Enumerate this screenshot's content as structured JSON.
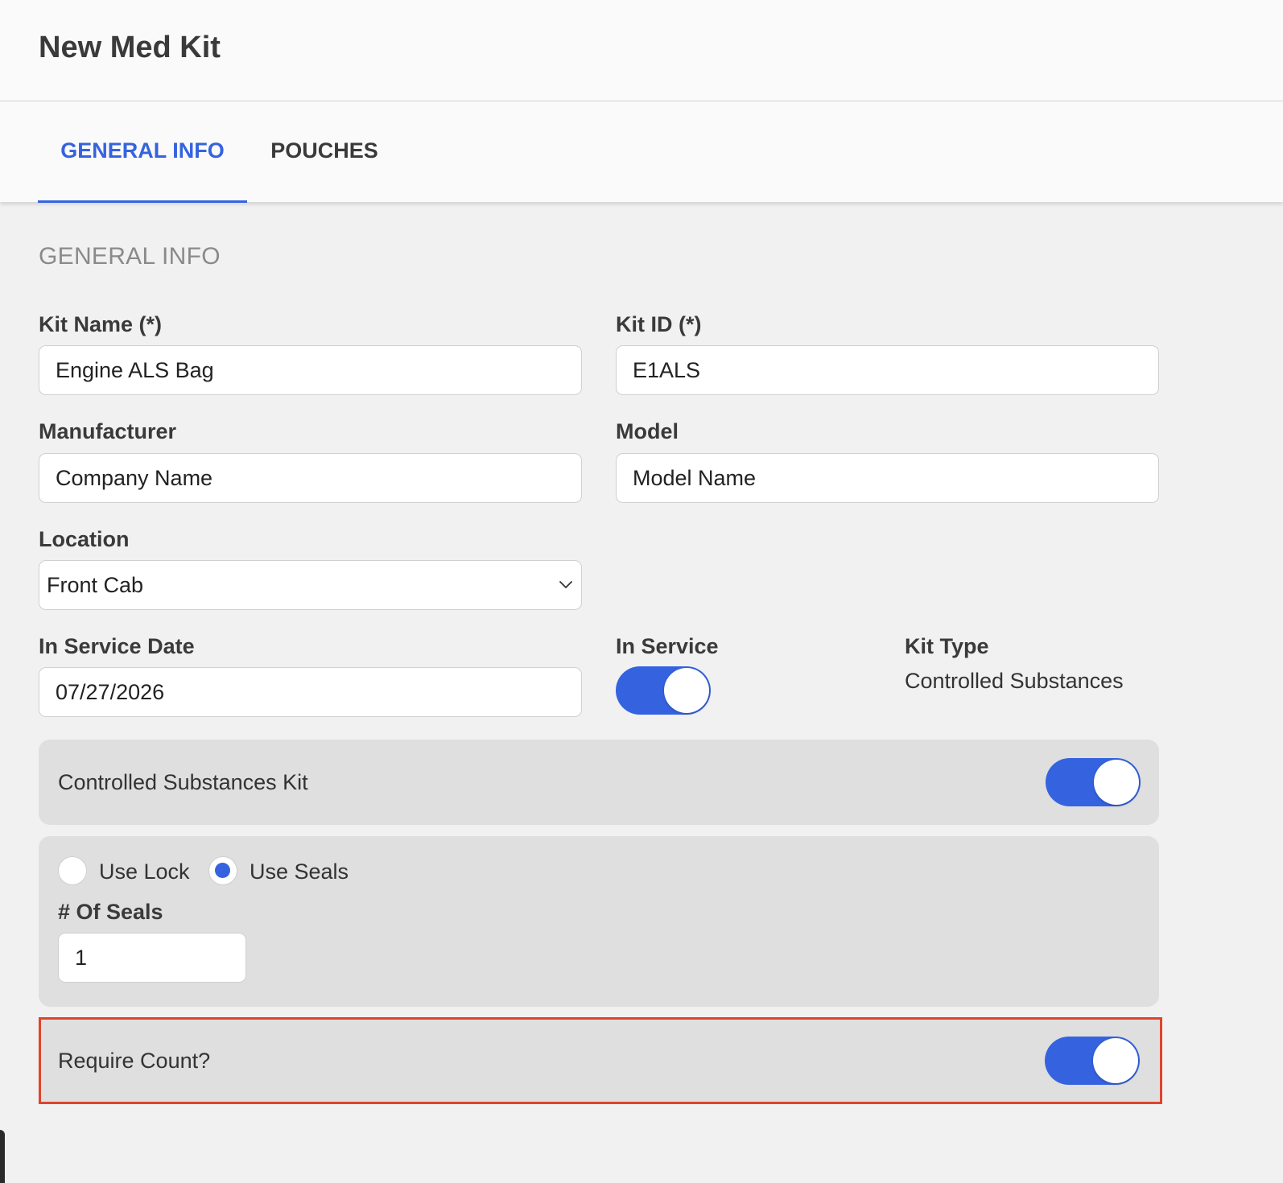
{
  "header": {
    "title": "New Med Kit"
  },
  "tabs": [
    {
      "label": "GENERAL INFO",
      "active": true
    },
    {
      "label": "POUCHES",
      "active": false
    }
  ],
  "section": {
    "title": "GENERAL INFO"
  },
  "fields": {
    "kit_name": {
      "label": "Kit Name (*)",
      "value": "Engine ALS Bag"
    },
    "kit_id": {
      "label": "Kit ID (*)",
      "value": "E1ALS"
    },
    "manufacturer": {
      "label": "Manufacturer",
      "value": "Company Name"
    },
    "model": {
      "label": "Model",
      "value": "Model Name"
    },
    "location": {
      "label": "Location",
      "value": "Front Cab"
    },
    "in_service_date": {
      "label": "In Service Date",
      "value": "07/27/2026"
    },
    "in_service": {
      "label": "In Service",
      "on": true
    },
    "kit_type": {
      "label": "Kit Type",
      "value": "Controlled Substances"
    }
  },
  "controlled_substances": {
    "label": "Controlled Substances Kit",
    "on": true
  },
  "security": {
    "use_lock_label": "Use Lock",
    "use_seals_label": "Use Seals",
    "selected": "use_seals",
    "seals_label": "# Of Seals",
    "seals_value": "1"
  },
  "require_count": {
    "label": "Require Count?",
    "on": true
  },
  "colors": {
    "accent": "#3563e0",
    "highlight": "#e0442c"
  }
}
